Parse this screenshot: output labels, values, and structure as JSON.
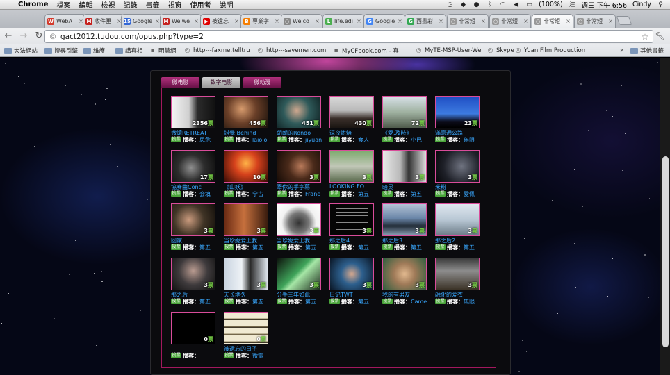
{
  "menubar": {
    "app": "Chrome",
    "items": [
      "檔案",
      "編輯",
      "檢視",
      "記錄",
      "書籤",
      "視窗",
      "使用者",
      "說明"
    ],
    "battery": "(100%)",
    "clock": "週三 下午 6:56",
    "user": "Cindy"
  },
  "tabs": [
    {
      "label": "WebA",
      "color": "#d33a2c",
      "glyph": "W"
    },
    {
      "label": "收件匣",
      "color": "#c5221f",
      "glyph": "M"
    },
    {
      "label": "Google",
      "color": "#3367d6",
      "glyph": "15"
    },
    {
      "label": "Weiwe",
      "color": "#c5221f",
      "glyph": "M"
    },
    {
      "label": "被遺忘",
      "color": "#e00000",
      "glyph": "▶"
    },
    {
      "label": "專業字",
      "color": "#f57d00",
      "glyph": "B"
    },
    {
      "label": "Welco",
      "color": "#888888",
      "glyph": "○"
    },
    {
      "label": "life.edi",
      "color": "#4caf50",
      "glyph": "L"
    },
    {
      "label": "Google",
      "color": "#4285f4",
      "glyph": "G"
    },
    {
      "label": "西畫彩",
      "color": "#34a853",
      "glyph": "G"
    },
    {
      "label": "非常短",
      "color": "#999999",
      "glyph": "○"
    },
    {
      "label": "非常短",
      "color": "#999999",
      "glyph": "○"
    },
    {
      "label": "非常短",
      "color": "#999999",
      "glyph": "○"
    },
    {
      "label": "非常短",
      "color": "#999999",
      "glyph": "○"
    }
  ],
  "omnibox": {
    "url": "gact2012.tudou.com/opus.php?type=2"
  },
  "bookmarks": [
    {
      "label": "大法網站",
      "icon": "folder"
    },
    {
      "label": "搜尋引擎",
      "icon": "folder"
    },
    {
      "label": "維護",
      "icon": "folder"
    },
    {
      "label": "講真相",
      "icon": "folder"
    },
    {
      "label": "明慧網",
      "icon": "page"
    },
    {
      "label": "http---faxme.telltru",
      "icon": "globe"
    },
    {
      "label": "http---savemen.com",
      "icon": "globe"
    },
    {
      "label": "MyCFbook.com - 真",
      "icon": "page"
    },
    {
      "label": "MyTE-MSP-User-We",
      "icon": "globe"
    },
    {
      "label": "Skype",
      "icon": "globe"
    },
    {
      "label": "Yuan Film Production",
      "icon": "globe"
    },
    {
      "label": "»",
      "icon": "none"
    },
    {
      "label": "其他書籤",
      "icon": "folder"
    }
  ],
  "content_tabs": [
    "微电影",
    "数字电影",
    "微动漫"
  ],
  "active_content_tab": 1,
  "vote_unit": "票",
  "uploader_label": "播客：",
  "badge_label": "投票",
  "items": [
    {
      "votes": "2356",
      "title": "微镜RETREAT",
      "uploader": "思危",
      "theme": "bw"
    },
    {
      "votes": "456",
      "title": "錯覺 Behind",
      "uploader": "laiolo",
      "theme": "warm"
    },
    {
      "votes": "451",
      "title": "朗朗的Rondo",
      "uploader": "jiyuan",
      "theme": "teal"
    },
    {
      "votes": "430",
      "title": "深夜烘焙",
      "uploader": "食人",
      "theme": "office"
    },
    {
      "votes": "72",
      "title": "《愛.及時》",
      "uploader": "小巴",
      "theme": "road"
    },
    {
      "votes": "23",
      "title": "滿意通公路",
      "uploader": "無限",
      "theme": "sky"
    },
    {
      "votes": "17",
      "title": "協奏曲Conc",
      "uploader": "会填",
      "theme": "dark"
    },
    {
      "votes": "10",
      "title": "《山妖》",
      "uploader": "宁古",
      "theme": "fire"
    },
    {
      "votes": "3",
      "title": "牽你的手字幕",
      "uploader": "Franc",
      "theme": "brown"
    },
    {
      "votes": "3",
      "title": "LOOKING FO",
      "uploader": "第五",
      "theme": "hill"
    },
    {
      "votes": "3",
      "title": "暗灵",
      "uploader": "第五",
      "theme": "room"
    },
    {
      "votes": "3",
      "title": "米粉",
      "uploader": "愛佩",
      "theme": "darkroom"
    },
    {
      "votes": "3",
      "title": "回家",
      "uploader": "第五",
      "theme": "man"
    },
    {
      "votes": "3",
      "title": "当珍妮爱上我",
      "uploader": "第五",
      "theme": "redroom"
    },
    {
      "votes": "3",
      "title": "当珍妮爱上我",
      "uploader": "第五",
      "theme": "white"
    },
    {
      "votes": "3",
      "title": "那之后4",
      "uploader": "第五",
      "theme": "text"
    },
    {
      "votes": "3",
      "title": "那之后3",
      "uploader": "第五",
      "theme": "sea"
    },
    {
      "votes": "3",
      "title": "那之后2",
      "uploader": "第五",
      "theme": "beach"
    },
    {
      "votes": "3",
      "title": "那之后",
      "uploader": "第五",
      "theme": "guy"
    },
    {
      "votes": "3",
      "title": "天长地久",
      "uploader": "第五",
      "theme": "couple"
    },
    {
      "votes": "3",
      "title": "分手三年如此",
      "uploader": "第五",
      "theme": "green"
    },
    {
      "votes": "3",
      "title": "日记TWT",
      "uploader": "第五",
      "theme": "blue"
    },
    {
      "votes": "3",
      "title": "我的有男友",
      "uploader": "Came",
      "theme": "face"
    },
    {
      "votes": "3",
      "title": "融化的爱衣",
      "uploader": "無限",
      "theme": "shop"
    },
    {
      "votes": "0",
      "title": "",
      "uploader": "",
      "theme": "empty"
    },
    {
      "votes": "0",
      "title": "被遗忘的日子",
      "uploader": "微電",
      "theme": "blinds"
    }
  ]
}
